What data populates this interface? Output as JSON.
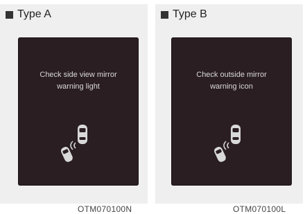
{
  "panels": [
    {
      "type_label": "Type A",
      "message": "Check side view mirror\nwarning light",
      "code": "OTM070100N"
    },
    {
      "type_label": "Type B",
      "message": "Check outside mirror\nwarning icon",
      "code": "OTM070100L"
    }
  ],
  "colors": {
    "panel_bg": "#efefef",
    "screen_bg": "#2a1e22",
    "text_light": "#d9d9d9"
  }
}
